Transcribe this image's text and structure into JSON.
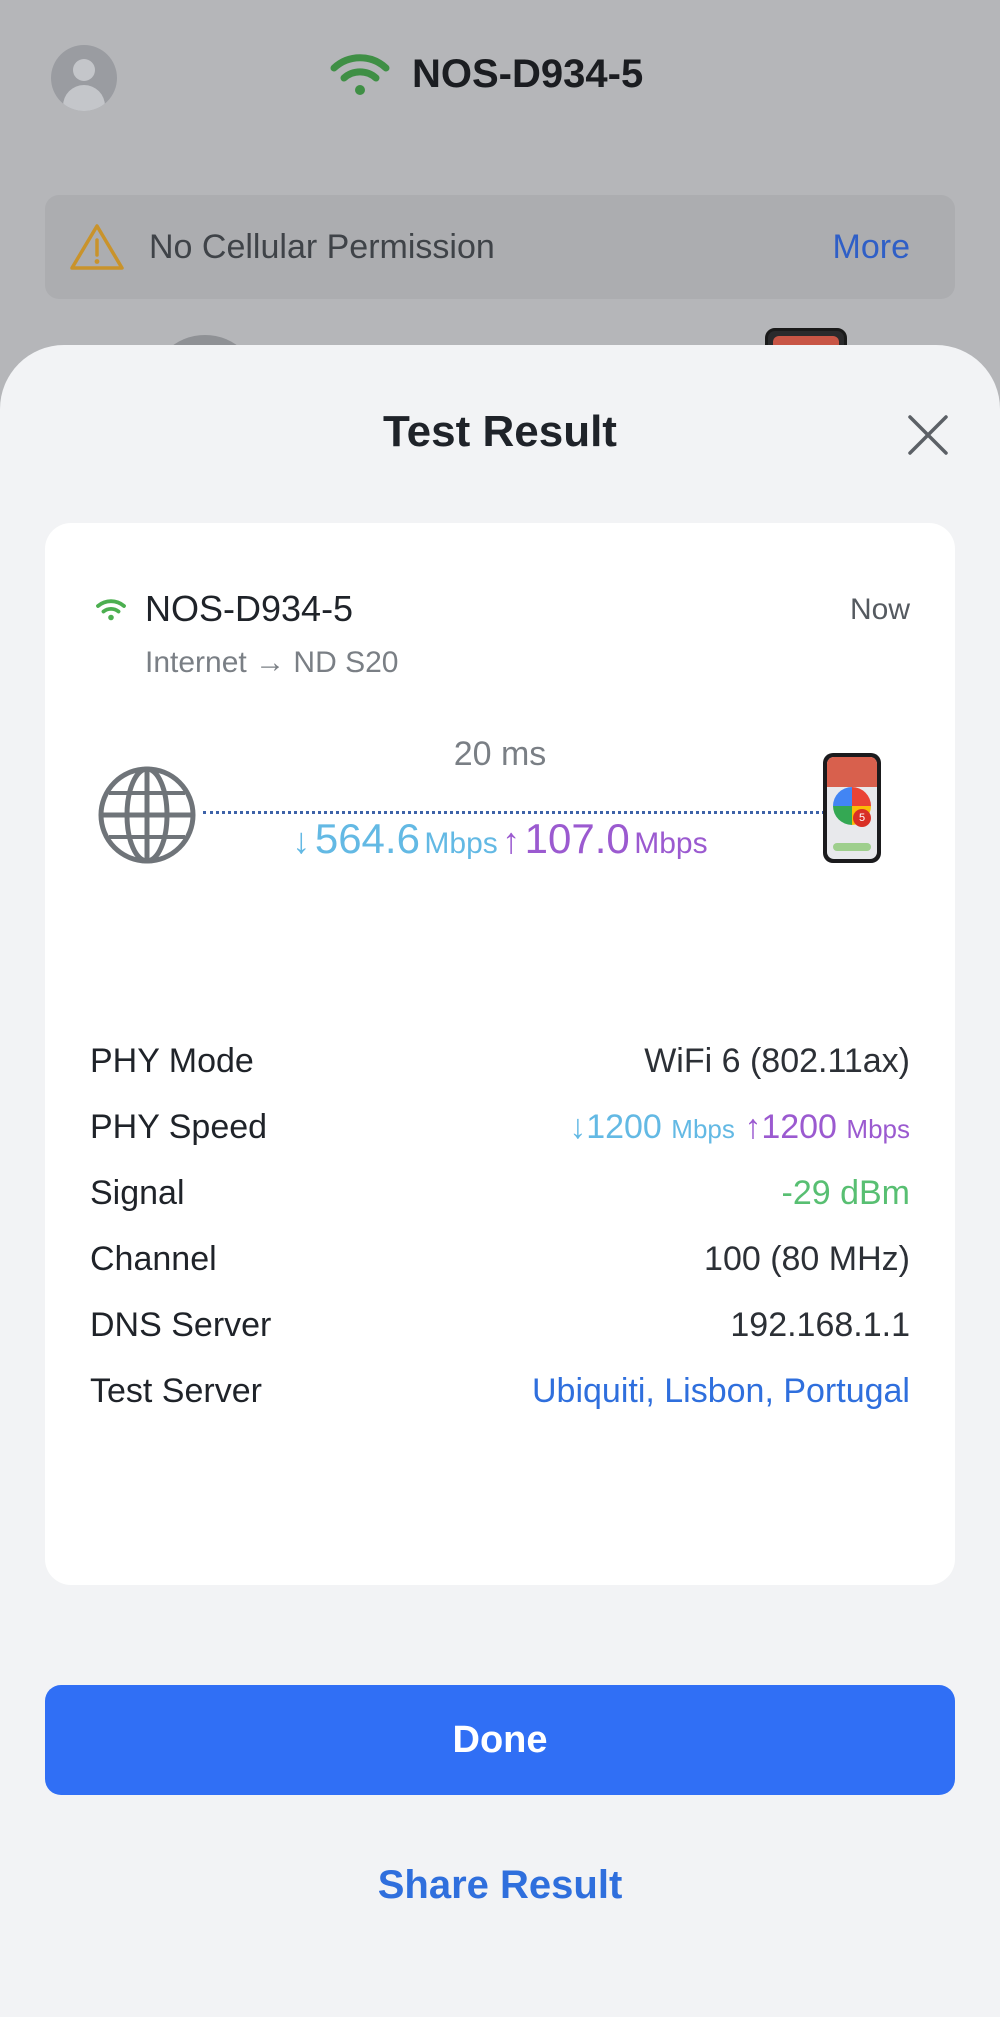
{
  "header": {
    "ssid": "NOS-D934-5"
  },
  "banner": {
    "message": "No Cellular Permission",
    "more_label": "More"
  },
  "sheet": {
    "title": "Test Result"
  },
  "result": {
    "ssid": "NOS-D934-5",
    "time": "Now",
    "path": "Internet → ND S20",
    "latency": "20 ms",
    "download_arrow": "↓",
    "download_value": "564.6",
    "download_unit": "Mbps",
    "upload_arrow": "↑",
    "upload_value": "107.0",
    "upload_unit": "Mbps",
    "phone_badge": "5"
  },
  "details": {
    "phy_mode_label": "PHY Mode",
    "phy_mode_value": "WiFi 6 (802.11ax)",
    "phy_speed_label": "PHY Speed",
    "phy_speed_down_arrow": "↓",
    "phy_speed_down": "1200",
    "phy_speed_down_unit": "Mbps",
    "phy_speed_up_arrow": "↑",
    "phy_speed_up": "1200",
    "phy_speed_up_unit": "Mbps",
    "signal_label": "Signal",
    "signal_value": "-29 dBm",
    "channel_label": "Channel",
    "channel_value": "100 (80 MHz)",
    "dns_label": "DNS Server",
    "dns_value": "192.168.1.1",
    "test_server_label": "Test Server",
    "test_server_value": "Ubiquiti, Lisbon, Portugal"
  },
  "actions": {
    "done_label": "Done",
    "share_label": "Share Result"
  },
  "colors": {
    "accent": "#306ff5",
    "download": "#63b9e4",
    "upload": "#9b5ad0",
    "signal_good": "#58bf72",
    "wifi_icon": "#4caf50"
  }
}
